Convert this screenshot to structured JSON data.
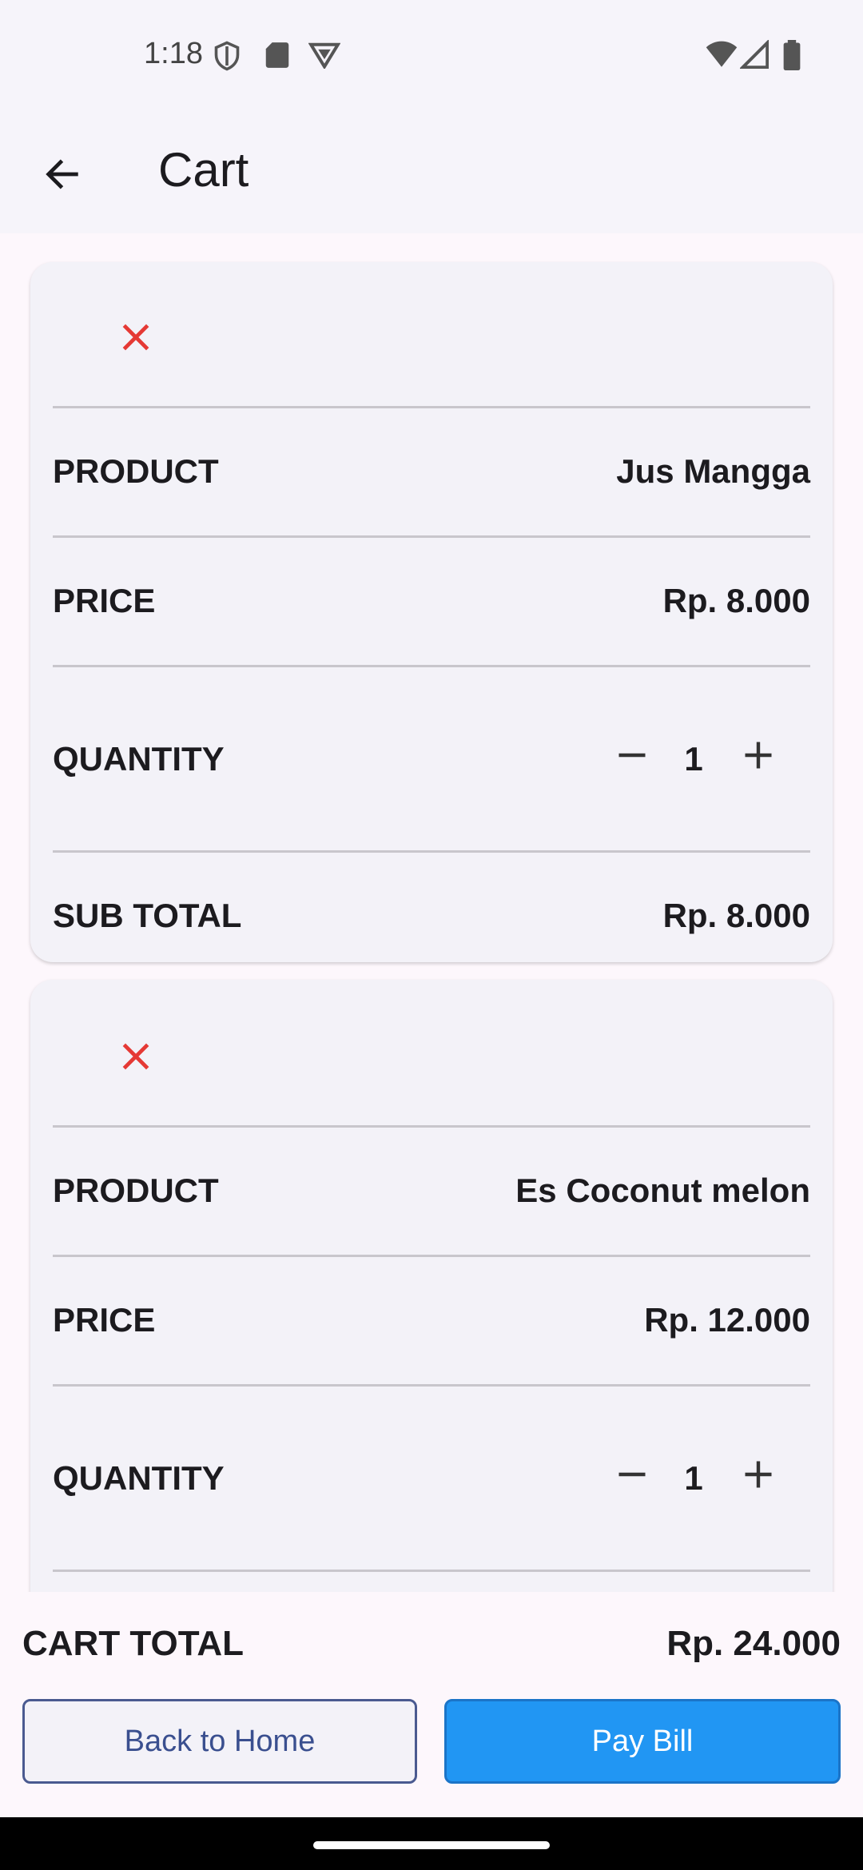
{
  "status_bar": {
    "time": "1:18"
  },
  "app_bar": {
    "title": "Cart"
  },
  "cart": {
    "items": [
      {
        "product_label": "PRODUCT",
        "product": "Jus Mangga",
        "price_label": "PRICE",
        "price": "Rp. 8.000",
        "quantity_label": "QUANTITY",
        "quantity": "1",
        "subtotal_label": "SUB TOTAL",
        "subtotal": "Rp. 8.000"
      },
      {
        "product_label": "PRODUCT",
        "product": "Es Coconut melon",
        "price_label": "PRICE",
        "price": "Rp. 12.000",
        "quantity_label": "QUANTITY",
        "quantity": "1"
      }
    ]
  },
  "footer": {
    "total_label": "CART TOTAL",
    "total_value": "Rp. 24.000",
    "back_label": "Back to Home",
    "pay_label": "Pay Bill"
  },
  "colors": {
    "remove_icon": "#e53935",
    "pay_button": "#2196f3",
    "outline_button": "#4a5a90"
  },
  "icons": {
    "back": "arrow-left-icon",
    "remove": "close-icon",
    "decrease": "minus-icon",
    "increase": "plus-icon"
  }
}
